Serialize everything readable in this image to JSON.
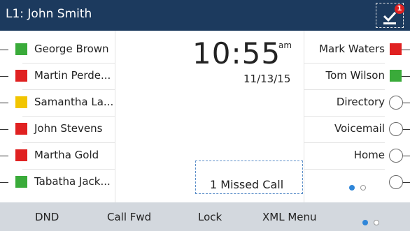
{
  "header": {
    "title": "L1: John Smith",
    "notification_count": "1"
  },
  "left_keys": [
    {
      "label": "George Brown",
      "status": "green"
    },
    {
      "label": "Martin Perde...",
      "status": "red"
    },
    {
      "label": "Samantha La...",
      "status": "yellow"
    },
    {
      "label": "John Stevens",
      "status": "red"
    },
    {
      "label": "Martha Gold",
      "status": "red"
    },
    {
      "label": "Tabatha Jack...",
      "status": "green"
    }
  ],
  "right_keys": [
    {
      "label": "Mark Waters",
      "status": "red"
    },
    {
      "label": "Tom Wilson",
      "status": "green"
    },
    {
      "label": "Directory",
      "status": "empty"
    },
    {
      "label": "Voicemail",
      "status": "empty"
    },
    {
      "label": "Home",
      "status": "empty"
    },
    {
      "label": "",
      "status": "empty"
    }
  ],
  "clock": {
    "time": "10:55",
    "ampm": "am",
    "date": "11/13/15"
  },
  "missed_call": {
    "text": "1  Missed Call"
  },
  "softkeys": [
    "DND",
    "Call Fwd",
    "Lock",
    "XML Menu"
  ],
  "colors": {
    "header": "#1c3a5e",
    "green": "#3aab3a",
    "red": "#e02121",
    "yellow": "#f2c500",
    "accent": "#2f86d9"
  }
}
